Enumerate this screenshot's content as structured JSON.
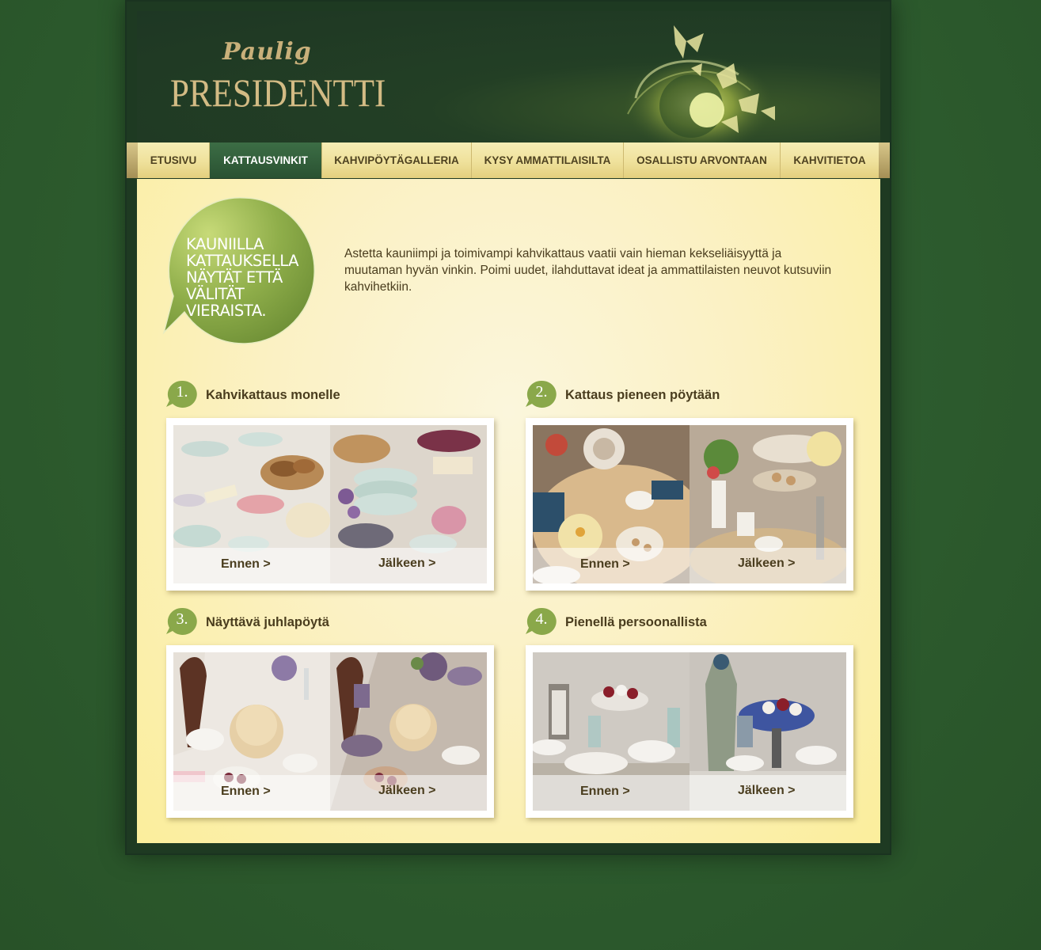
{
  "brand": {
    "paulig": "Paulig",
    "presidentti": "PRESIDENTTI"
  },
  "nav": {
    "items": [
      {
        "label": "ETUSIVU",
        "active": false
      },
      {
        "label": "KATTAUSVINKIT",
        "active": true
      },
      {
        "label": "KAHVIPÖYTÄGALLERIA",
        "active": false
      },
      {
        "label": "KYSY AMMATTILAISILTA",
        "active": false
      },
      {
        "label": "OSALLISTU ARVONTAAN",
        "active": false
      },
      {
        "label": "KAHVITIETOA",
        "active": false
      }
    ]
  },
  "hero": {
    "bubble_lines": [
      "KAUNIILLA",
      "KATTAUKSELLA",
      "NÄYTÄT ETTÄ",
      "VÄLITÄT",
      "VIERAISTA."
    ],
    "intro": "Astetta kauniimpi ja toimivampi kahvikattaus vaatii vain hieman kekseliäisyyttä ja muutaman hyvän vinkin. Poimi uudet, ilahduttavat ideat ja ammattilaisten neuvot kutsuviin kahvihetkiin."
  },
  "sections": [
    {
      "number": "1.",
      "title": "Kahvikattaus monelle",
      "before_label": "Ennen >",
      "after_label": "Jälkeen >"
    },
    {
      "number": "2.",
      "title": "Kattaus pieneen pöytään",
      "before_label": "Ennen >",
      "after_label": "Jälkeen >"
    },
    {
      "number": "3.",
      "title": "Näyttävä juhlapöytä",
      "before_label": "Ennen >",
      "after_label": "Jälkeen >"
    },
    {
      "number": "4.",
      "title": "Pienellä persoonallista",
      "before_label": "Ennen >",
      "after_label": "Jälkeen >"
    }
  ],
  "colors": {
    "background": "#2e5a2f",
    "header": "#1e3724",
    "nav_active": "#2f5a37",
    "nav_bar": "#efe19b",
    "content": "#fbf1c4",
    "accent_green": "#8aa84a",
    "text_brown": "#4a3d1e",
    "logo_gold": "#d3bb84"
  }
}
